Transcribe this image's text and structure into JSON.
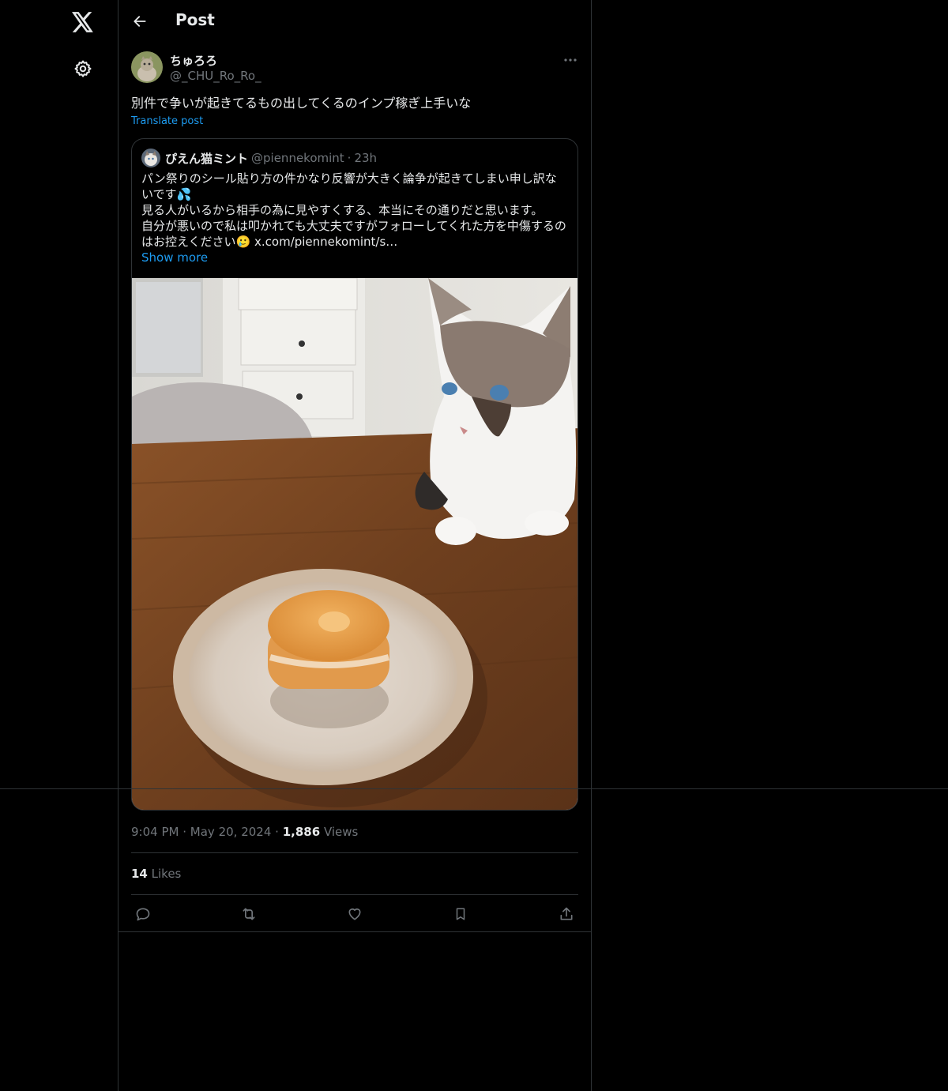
{
  "app": {
    "logo_icon": "x-logo-icon",
    "settings_icon": "gear-icon"
  },
  "header": {
    "title": "Post",
    "back_icon": "arrow-left-icon"
  },
  "post": {
    "author_name": "ちゅろろ",
    "author_handle": "@_CHU_Ro_Ro_",
    "text": "別件で争いが起きてるもの出してくるのインプ稼ぎ上手いな",
    "translate_label": "Translate post",
    "time": "9:04 PM",
    "date": "May 20, 2024",
    "views_count": "1,886",
    "views_label": "Views",
    "likes_count": "14",
    "likes_label": "Likes"
  },
  "quote": {
    "name": "ぴえん猫ミント",
    "handle": "@piennekomint",
    "separator": "·",
    "time": "23h",
    "lines": [
      "パン祭りのシール貼り方の件かなり反響が大きく論争が起きてしまい申し訳な",
      "いです💦",
      "見る人がいるから相手の為に見やすくする、本当にその通りだと思います。",
      "自分が悪いので私は叩かれても大丈夫ですがフォローしてくれた方を中傷するの",
      "はお控えください🥲 x.com/piennekomint/s…"
    ],
    "show_more": "Show more",
    "media_description_icon": "photo-cat-and-pastry"
  },
  "meta_separator": "·",
  "actions": {
    "reply_icon": "reply-icon",
    "repost_icon": "repost-icon",
    "like_icon": "heart-icon",
    "bookmark_icon": "bookmark-icon",
    "share_icon": "share-icon"
  },
  "colors": {
    "background": "#000000",
    "text": "#e7e9ea",
    "secondary": "#71767b",
    "accent": "#1d9bf0",
    "border": "#2f3336"
  }
}
